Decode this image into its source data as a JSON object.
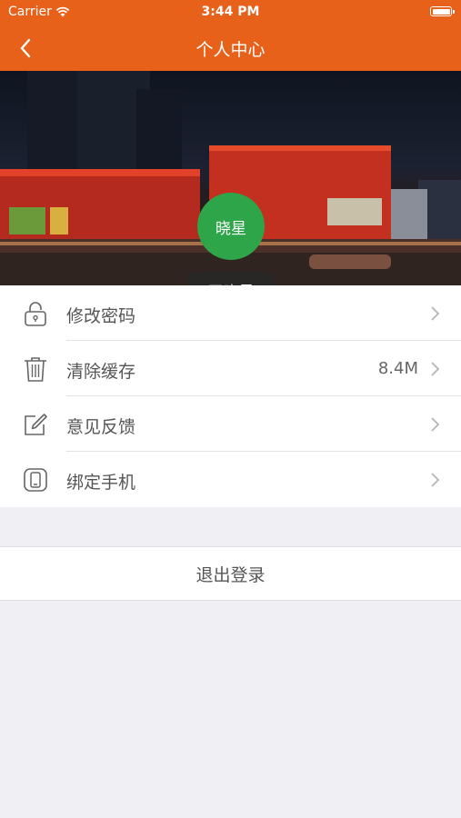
{
  "status_bar": {
    "carrier": "Carrier",
    "time": "3:44 PM"
  },
  "nav": {
    "title": "个人中心"
  },
  "profile": {
    "avatar_text": "晓星",
    "name": "王晓星"
  },
  "menu": [
    {
      "label": "修改密码",
      "value": "",
      "icon": "lock-icon"
    },
    {
      "label": "清除缓存",
      "value": "8.4M",
      "icon": "trash-icon"
    },
    {
      "label": "意见反馈",
      "value": "",
      "icon": "edit-icon"
    },
    {
      "label": "绑定手机",
      "value": "",
      "icon": "phone-icon"
    }
  ],
  "logout": {
    "label": "退出登录"
  },
  "colors": {
    "accent": "#e8611a",
    "avatar": "#2fa54a",
    "background": "#efeff4"
  }
}
